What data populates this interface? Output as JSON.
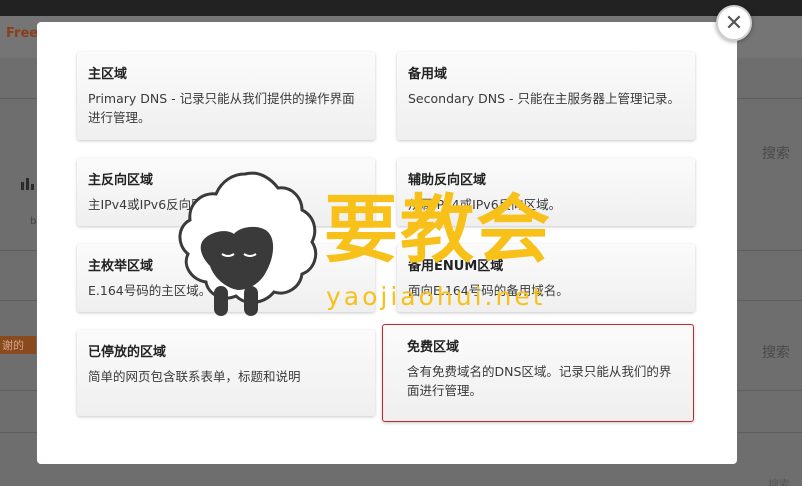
{
  "background": {
    "brand": "Free",
    "search_label": "搜索",
    "tag_label": "谢的",
    "bottom_label": "搜索"
  },
  "modal": {
    "close_glyph": "✕",
    "cards": [
      {
        "title": "主区域",
        "desc": "Primary DNS - 记录只能从我们提供的操作界面进行管理。"
      },
      {
        "title": "备用域",
        "desc": "Secondary DNS - 只能在主服务器上管理记录。"
      },
      {
        "title": "主反向区域",
        "desc": "主IPv4或IPv6反向区域。"
      },
      {
        "title": "辅助反向区域",
        "desc": "从属IPv4或IPv6反向区域。"
      },
      {
        "title": "主枚举区域",
        "desc": "E.164号码的主区域。"
      },
      {
        "title": "备用ENUM区域",
        "desc": "面向E.164号码的备用域名。"
      },
      {
        "title": "已停放的区域",
        "desc": "简单的网页包含联系表单，标题和说明"
      },
      {
        "title": "免费区域",
        "desc": "含有免费域名的DNS区域。记录只能从我们的界面进行管理。"
      }
    ],
    "selected_index": 7
  },
  "watermark": {
    "text": "要教会",
    "url": "yaojiaohui.net"
  },
  "colors": {
    "accent": "#c9252c",
    "watermark": "#f7c11a"
  }
}
